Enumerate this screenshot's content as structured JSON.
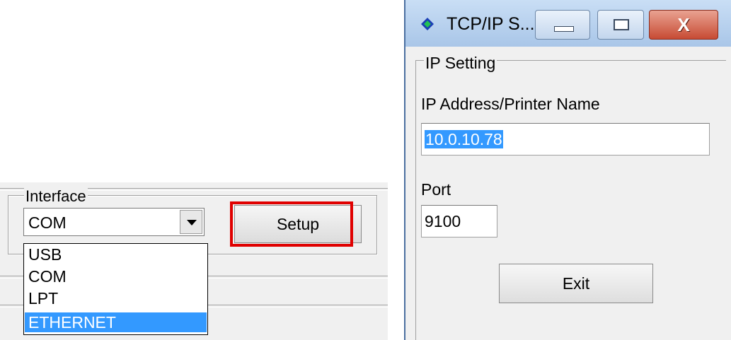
{
  "left": {
    "group_label": "Interface",
    "combo_value": "COM",
    "setup_label": "Setup",
    "options": [
      "USB",
      "COM",
      "LPT",
      "ETHERNET"
    ],
    "selected_option": "ETHERNET"
  },
  "dialog": {
    "title": "TCP/IP S...",
    "group_label": "IP Setting",
    "ip_label": "IP Address/Printer Name",
    "ip_value": "10.0.10.78",
    "port_label": "Port",
    "port_value": "9100",
    "exit_label": "Exit",
    "close_glyph": "X"
  },
  "colors": {
    "highlight": "#e00000",
    "selection": "#3399ff"
  }
}
